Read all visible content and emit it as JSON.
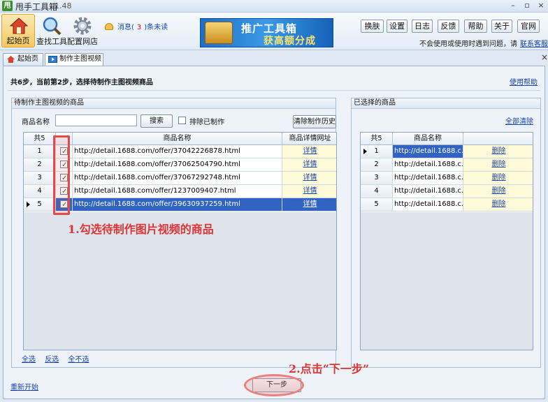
{
  "window": {
    "title": "甩手工具箱",
    "version": "1.48",
    "app_icon_text": "甩",
    "controls": [
      "–",
      "▫",
      "×"
    ]
  },
  "toolbar": {
    "tools": [
      {
        "label": "起始页",
        "icon": "home-icon",
        "active": true
      },
      {
        "label": "查找工具",
        "icon": "search-icon",
        "active": false
      },
      {
        "label": "配置网店",
        "icon": "gear-icon",
        "active": false
      }
    ],
    "message": {
      "prefix": "消息(",
      "count": "3",
      "suffix": ")条未读"
    },
    "banner": {
      "line1": "推广工具箱",
      "line2": "获高额分成"
    },
    "buttons": [
      "换肤",
      "设置",
      "日志",
      "反馈",
      "帮助",
      "关于",
      "官网"
    ],
    "help_note": "不会使用或使用时遇到问题，请",
    "help_link": "联系客服"
  },
  "tabs": [
    {
      "label": "起始页",
      "icon": "house-icon"
    },
    {
      "label": "制作主图视频",
      "icon": "video-icon"
    }
  ],
  "tab_close": "×",
  "step": {
    "title": "共6步，当前第2步，选择待制作主图视频商品",
    "help_link": "使用帮助"
  },
  "left_panel": {
    "title": "待制作主图视频的商品",
    "name_label": "商品名称",
    "name_value": "",
    "search_button": "搜索",
    "exclude_label": "排除已制作",
    "clear_history_button": "清除制作历史",
    "columns": [
      "共5",
      "",
      "商品名称",
      "商品详情网址"
    ],
    "rows": [
      {
        "no": "1",
        "checked": true,
        "url": "http://detail.1688.com/offer/37042226878.html",
        "detail": "详情"
      },
      {
        "no": "2",
        "checked": true,
        "url": "http://detail.1688.com/offer/37062504790.html",
        "detail": "详情"
      },
      {
        "no": "3",
        "checked": true,
        "url": "http://detail.1688.com/offer/37067292748.html",
        "detail": "详情"
      },
      {
        "no": "4",
        "checked": true,
        "url": "http://detail.1688.com/offer/1237009407.html",
        "detail": "详情"
      },
      {
        "no": "5",
        "checked": true,
        "url": "http://detail.1688.com/offer/39630937259.html",
        "detail": "详情"
      }
    ],
    "bottom_links": [
      "全选",
      "反选",
      "全不选"
    ]
  },
  "right_panel": {
    "title": "已选择的商品",
    "clear_all": "全部清除",
    "columns": [
      "共5",
      "商品名称",
      ""
    ],
    "rows": [
      {
        "no": "1",
        "url": "http://detail.1688.c...",
        "action": "删除"
      },
      {
        "no": "2",
        "url": "http://detail.1688.c...",
        "action": "删除"
      },
      {
        "no": "3",
        "url": "http://detail.1688.c...",
        "action": "删除"
      },
      {
        "no": "4",
        "url": "http://detail.1688.c...",
        "action": "删除"
      },
      {
        "no": "5",
        "url": "http://detail.1688.c...",
        "action": "删除"
      }
    ]
  },
  "footer": {
    "restart": "重新开始",
    "next_button": "下一步"
  },
  "annotations": {
    "step1": "1.勾选待制作图片视频的商品",
    "step2": "2.点击“下一步”"
  }
}
